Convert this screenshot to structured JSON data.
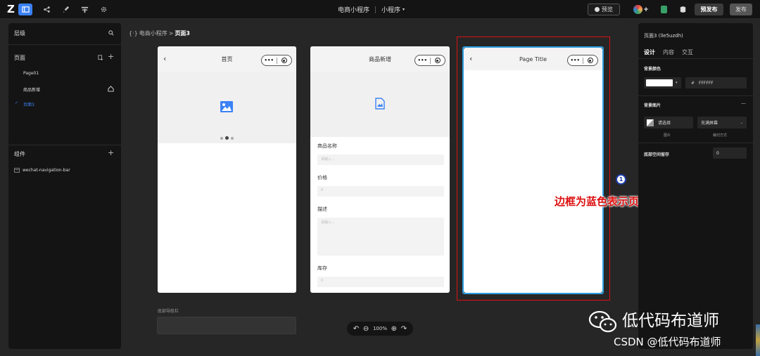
{
  "topbar": {
    "logo": "Z",
    "app_name": "电商小程序",
    "app_type": "小程序",
    "app_type_caret": "▾",
    "preview_label": "预览",
    "user_badge": "+",
    "pre_publish_label": "预发布",
    "publish_label": "发布"
  },
  "left_panel": {
    "title": "层级",
    "pages_heading": "页面",
    "pages": [
      {
        "label": "Page01"
      },
      {
        "label": "商品新增"
      },
      {
        "label": "页面3",
        "selected": true
      }
    ],
    "components_heading": "组件",
    "components": [
      {
        "label": "wechat-navigation-bar"
      }
    ]
  },
  "breadcrumb": {
    "icon": "{·}",
    "parent": "电商小程序",
    "separator": ">",
    "current": "页面3"
  },
  "phones": [
    {
      "title": "首页",
      "back": "‹",
      "capsule_dots": "•••"
    },
    {
      "title": "商品新增",
      "capsule_dots": "•••",
      "fields": [
        {
          "label": "商品名称",
          "placeholder": "请输入..."
        },
        {
          "label": "价格",
          "placeholder": "0"
        },
        {
          "label": "描述",
          "placeholder": "请输入..."
        },
        {
          "label": "库存",
          "placeholder": "0"
        }
      ]
    },
    {
      "title": "Page Title",
      "back": "‹",
      "capsule_dots": "•••"
    }
  ],
  "annotation": {
    "number": "1",
    "text": "边框为蓝色表示页面被选中了"
  },
  "bottom": {
    "footer_label": "底部导航栏",
    "zoom": "100%"
  },
  "right_panel": {
    "title": "页面3 (lle5uzdh)",
    "tabs": [
      {
        "label": "设计",
        "active": true
      },
      {
        "label": "内容"
      },
      {
        "label": "交互"
      }
    ],
    "bg_color_label": "背景颜色",
    "bg_color_value": "FFFFFF",
    "bg_color_hash": "#",
    "bg_image_label": "背景图片",
    "collapse": "—",
    "choose_image": "请选择",
    "image_caption": "图片",
    "fit_value": "充满屏幕",
    "fit_caption": "裁切方式",
    "bottom_space_label": "底部空间留存",
    "bottom_space_value": "0"
  },
  "watermark": {
    "line1": "低代码布道师",
    "line2": "CSDN @低代码布道师"
  },
  "colors": {
    "accent": "#3b82f6",
    "selection_blue": "#2f9fe0",
    "annotation_red": "#dd1111"
  }
}
